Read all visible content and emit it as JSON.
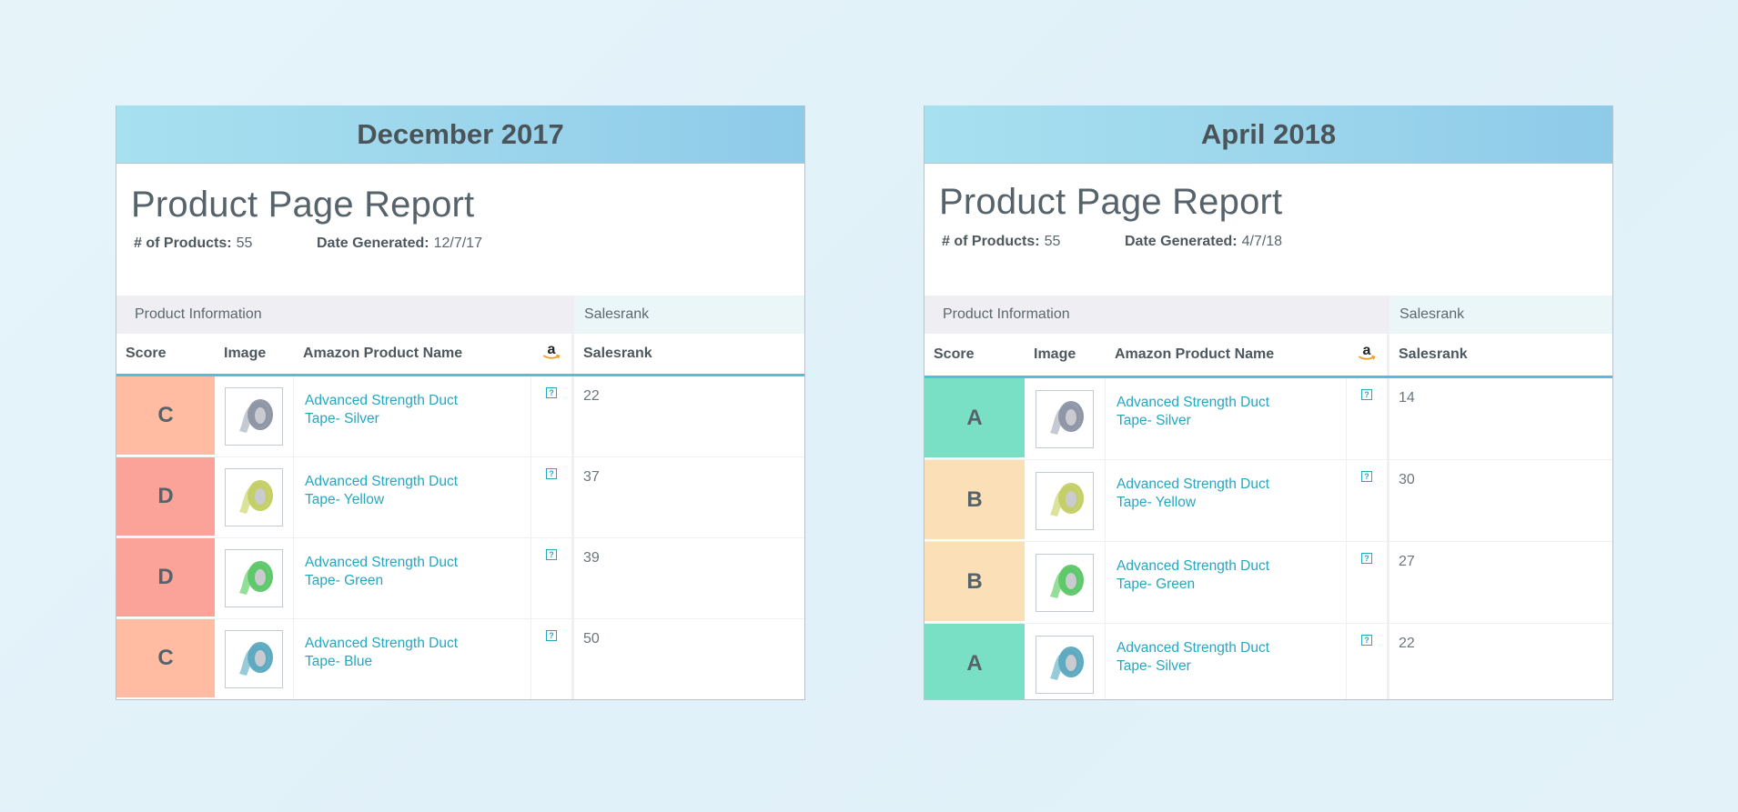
{
  "score_colors": {
    "A": "#7ae0c5",
    "B": "#fbdfb6",
    "C": "#ffbca2",
    "D": "#fba398"
  },
  "tape_colors": {
    "Silver": {
      "outer": "#8f97a7",
      "inner": "#c5c9d2"
    },
    "Yellow": {
      "outer": "#c4cf68",
      "inner": "#dbe29a"
    },
    "Green": {
      "outer": "#5fc86a",
      "inner": "#93df97"
    },
    "Blue": {
      "outer": "#5eaac0",
      "inner": "#97cbd9"
    }
  },
  "panels": [
    {
      "period": "December 2017",
      "report_title": "Product Page Report",
      "products_label": "# of Products:",
      "products_value": "55",
      "date_label": "Date Generated:",
      "date_value": "12/7/17",
      "group_info": "Product Information",
      "group_sales": "Salesrank",
      "columns": {
        "score": "Score",
        "image": "Image",
        "name": "Amazon Product Name",
        "amazon_icon": "amazon-logo-icon",
        "salesrank": "Salesrank"
      },
      "rows": [
        {
          "score": "C",
          "name": "Advanced Strength Duct Tape- Silver",
          "tape": "Silver",
          "salesrank": "22"
        },
        {
          "score": "D",
          "name": "Advanced Strength Duct Tape- Yellow",
          "tape": "Yellow",
          "salesrank": "37"
        },
        {
          "score": "D",
          "name": "Advanced Strength Duct Tape- Green",
          "tape": "Green",
          "salesrank": "39"
        },
        {
          "score": "C",
          "name": "Advanced Strength Duct Tape- Blue",
          "tape": "Blue",
          "salesrank": "50"
        }
      ]
    },
    {
      "period": "April 2018",
      "report_title": "Product Page Report",
      "products_label": "# of Products:",
      "products_value": "55",
      "date_label": "Date Generated:",
      "date_value": "4/7/18",
      "group_info": "Product Information",
      "group_sales": "Salesrank",
      "columns": {
        "score": "Score",
        "image": "Image",
        "name": "Amazon Product Name",
        "amazon_icon": "amazon-logo-icon",
        "salesrank": "Salesrank"
      },
      "rows": [
        {
          "score": "A",
          "name": "Advanced Strength Duct Tape- Silver",
          "tape": "Silver",
          "salesrank": "14"
        },
        {
          "score": "B",
          "name": "Advanced Strength Duct Tape- Yellow",
          "tape": "Yellow",
          "salesrank": "30"
        },
        {
          "score": "B",
          "name": "Advanced Strength Duct Tape- Green",
          "tape": "Green",
          "salesrank": "27"
        },
        {
          "score": "A",
          "name": "Advanced Strength Duct Tape- Silver",
          "tape": "Blue",
          "salesrank": "22"
        }
      ]
    }
  ]
}
